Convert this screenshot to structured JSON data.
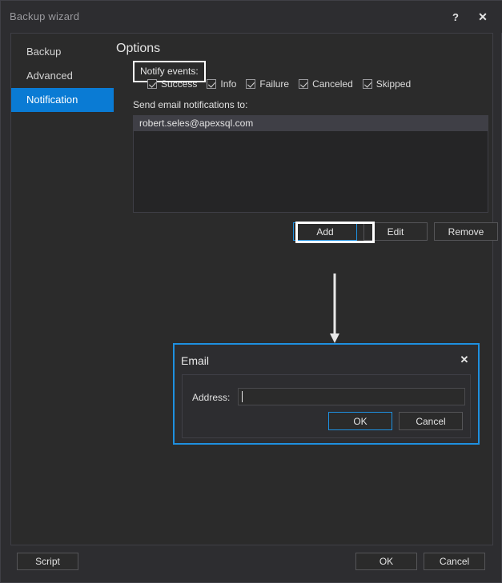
{
  "window": {
    "title": "Backup wizard",
    "help_icon": "?",
    "close_icon": "✕"
  },
  "sidebar": {
    "items": [
      {
        "label": "Backup",
        "selected": false
      },
      {
        "label": "Advanced",
        "selected": false
      },
      {
        "label": "Notification",
        "selected": true
      }
    ]
  },
  "options": {
    "heading": "Options",
    "notify_events_label": "Notify events:",
    "events": [
      {
        "label": "Success",
        "checked": true
      },
      {
        "label": "Info",
        "checked": true
      },
      {
        "label": "Failure",
        "checked": true
      },
      {
        "label": "Canceled",
        "checked": true
      },
      {
        "label": "Skipped",
        "checked": true
      }
    ],
    "send_email_label": "Send email notifications to:",
    "recipients": [
      {
        "email": "robert.seles@apexsql.com",
        "selected": true
      }
    ],
    "list_buttons": {
      "add": "Add",
      "edit": "Edit",
      "remove": "Remove"
    }
  },
  "email_dialog": {
    "title": "Email",
    "close_icon": "✕",
    "address_label": "Address:",
    "address_value": "",
    "address_placeholder": "",
    "ok": "OK",
    "cancel": "Cancel"
  },
  "footer": {
    "script": "Script",
    "ok": "OK",
    "cancel": "Cancel"
  },
  "colors": {
    "accent_blue": "#0a7bd4",
    "focus_blue": "#1e90e0",
    "annotation_white": "#ffffff",
    "window_bg": "#2d2d30",
    "panel_bg": "#2b2b2b",
    "listbox_bg": "#252526",
    "selected_row": "#3f3f46"
  }
}
